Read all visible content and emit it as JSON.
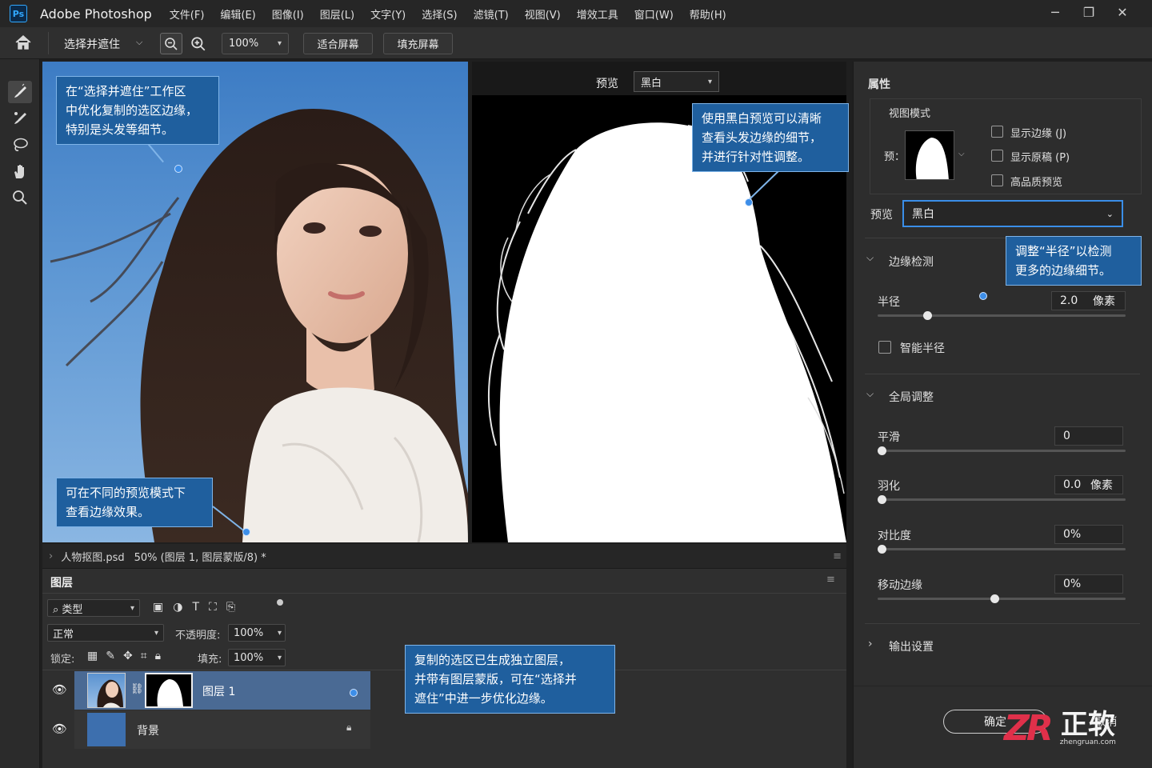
{
  "app": {
    "logo": "Ps",
    "title": "Adobe Photoshop"
  },
  "menu": [
    "文件(F)",
    "编辑(E)",
    "图像(I)",
    "图层(L)",
    "文字(Y)",
    "选择(S)",
    "滤镜(T)",
    "视图(V)",
    "增效工具",
    "窗口(W)",
    "帮助(H)"
  ],
  "options": {
    "workspace": "选择并遮住",
    "zoom": "100%",
    "fit": "适合屏幕",
    "fill": "填充屏幕"
  },
  "preview_bar": {
    "label": "预览",
    "value": "黑白"
  },
  "callouts": {
    "c1": [
      "在“选择并遮住”工作区",
      "中优化复制的选区边缘，",
      "特别是头发等细节。"
    ],
    "c2": [
      "可在不同的预览模式下",
      "查看边缘效果。"
    ],
    "c3": [
      "使用黑白预览可以清晰",
      "查看头发边缘的细节，",
      "并进行针对性调整。"
    ],
    "c4": [
      "调整“半径”以检测",
      "更多的边缘细节。"
    ],
    "c5": [
      "复制的选区已生成独立图层，",
      "并带有图层蒙版，可在“选择并",
      "遮住”中进一步优化边缘。"
    ]
  },
  "status": {
    "file": "人物抠图.psd",
    "info": "50% (图层 1, 图层蒙版/8) *"
  },
  "layers": {
    "title": "图层",
    "filter": "类型",
    "blend": "正常",
    "opacity_label": "不透明度:",
    "opacity": "100%",
    "lock_label": "锁定:",
    "fill_label": "填充:",
    "fill": "100%",
    "rows": [
      {
        "name": "图层 1"
      },
      {
        "name": "背景"
      }
    ]
  },
  "props": {
    "title": "属性",
    "view_mode": "视图模式",
    "view_label": "预：",
    "show_edge": "显示边缘 (J)",
    "show_original": "显示原稿 (P)",
    "hq_preview": "高品质预览",
    "preview_label": "预览",
    "preview_value": "黑白",
    "edge_detect": "边缘检测",
    "radius_label": "半径",
    "radius_value": "2.0",
    "radius_unit": "像素",
    "radius_slider": 0.2,
    "smart_radius": "智能半径",
    "global": "全局调整",
    "smooth_label": "平滑",
    "smooth_value": "0",
    "feather_label": "羽化",
    "feather_value": "0.0",
    "feather_unit": "像素",
    "contrast_label": "对比度",
    "contrast_value": "0%",
    "shift_label": "移动边缘",
    "shift_value": "0%",
    "output": "输出设置",
    "ok": "确定",
    "cancel": "取消"
  },
  "watermark": {
    "logo": "ZR",
    "brand": "正软",
    "url": "zhengruan.com"
  }
}
